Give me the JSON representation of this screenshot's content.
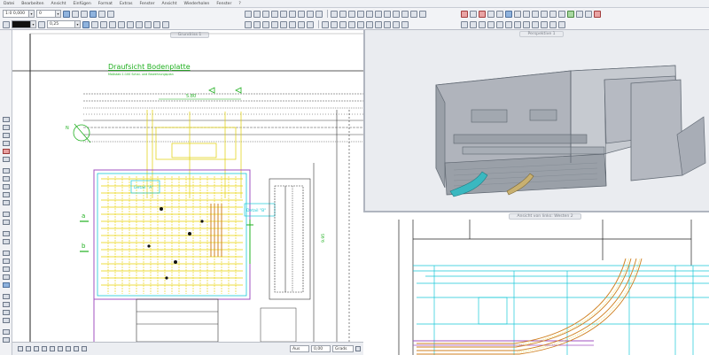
{
  "menu": [
    "Datei",
    "Bearbeiten",
    "Ansicht",
    "Einfügen",
    "Format",
    "Extras",
    "Fenster",
    "Ansicht",
    "Wiederholen",
    "Fenster",
    "?"
  ],
  "toolbar": {
    "scale_value": "1:0  0,000",
    "layer_value": "0",
    "line_weight": "0,25",
    "color_value": ""
  },
  "windows": {
    "plan": {
      "title": "Grundriss 1"
    },
    "perspective": {
      "title": "Perspektive 1"
    },
    "view": {
      "title": "Ansicht von links: Westen 2"
    }
  },
  "drawing": {
    "heading": "Draufsicht Bodenplatte",
    "subheading": "Maßstab 1:100 Schal- und Bewehrungsplan",
    "dim_top": "5.80",
    "detail_a": "Detail \"A\"",
    "detail_b": "Detail \"B\"",
    "section_a": "a",
    "section_b": "b",
    "dim_side": "9.95",
    "north": "N"
  },
  "statusbar": {
    "mode": "Aus",
    "zoom": "0,00",
    "unit": "Grads"
  },
  "colors": {
    "plan_line": "#222222",
    "yellow": "#f0e000",
    "green": "#20b020",
    "cyan": "#18c8d8",
    "purple": "#a050c0",
    "orange": "#d08020",
    "model_face": "#c0c4ca",
    "model_edge": "#606870"
  }
}
